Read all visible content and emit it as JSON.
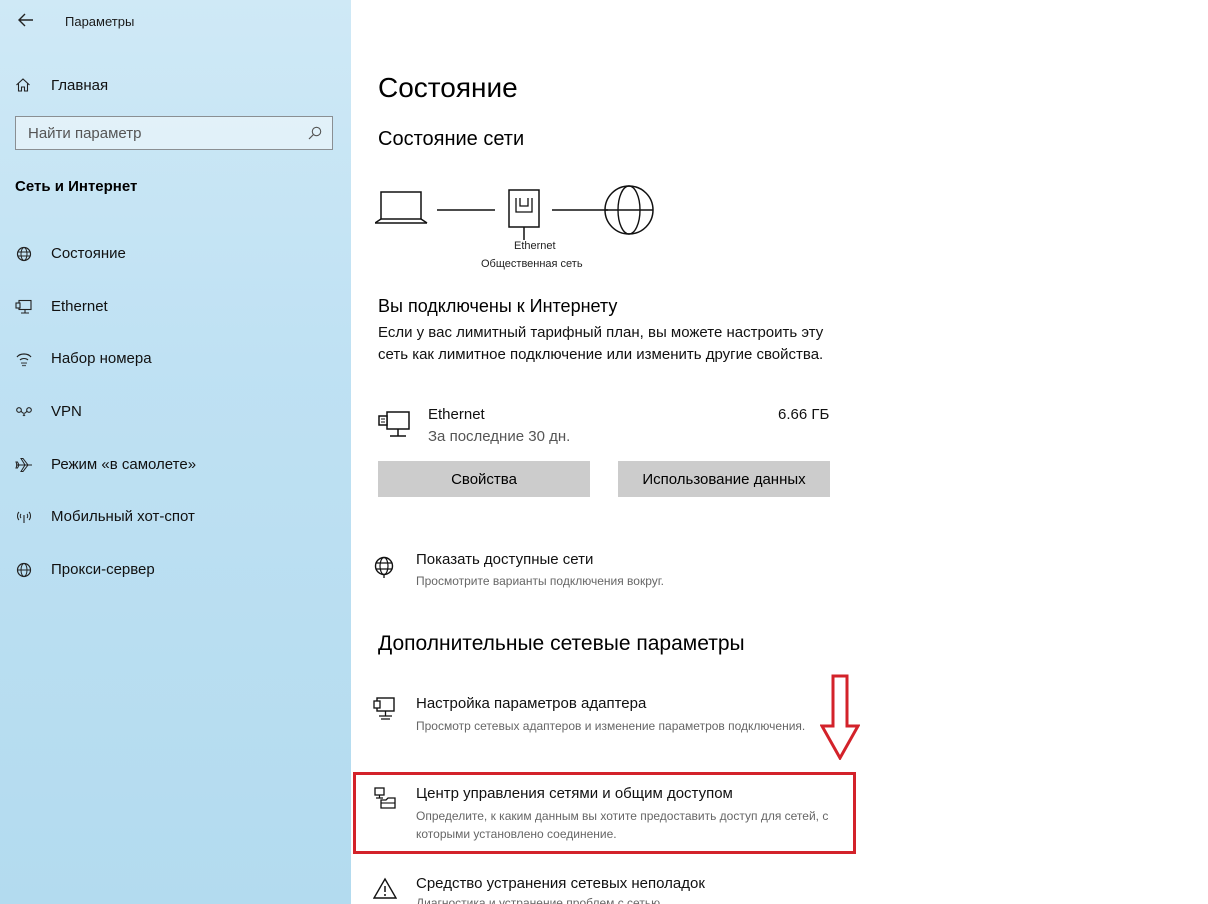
{
  "window": {
    "title": "Параметры"
  },
  "sidebar": {
    "home_label": "Главная",
    "search": {
      "placeholder": "Найти параметр"
    },
    "section_title": "Сеть и Интернет",
    "items": [
      {
        "label": "Состояние",
        "icon": "globe-icon"
      },
      {
        "label": "Ethernet",
        "icon": "ethernet-icon"
      },
      {
        "label": "Набор номера",
        "icon": "dialup-icon"
      },
      {
        "label": "VPN",
        "icon": "vpn-icon"
      },
      {
        "label": "Режим «в самолете»",
        "icon": "airplane-icon"
      },
      {
        "label": "Мобильный хот-спот",
        "icon": "hotspot-icon"
      },
      {
        "label": "Прокси-сервер",
        "icon": "globe-icon"
      }
    ]
  },
  "main": {
    "page_title": "Состояние",
    "network_status_title": "Состояние сети",
    "diagram": {
      "adapter_label": "Ethernet",
      "network_type": "Общественная сеть"
    },
    "connected": {
      "title": "Вы подключены к Интернету",
      "description": "Если у вас лимитный тарифный план, вы можете настроить эту сеть как лимитное подключение или изменить другие свойства."
    },
    "adapter": {
      "name": "Ethernet",
      "period": "За последние 30 дн.",
      "usage": "6.66 ГБ"
    },
    "buttons": {
      "properties": "Свойства",
      "data_usage": "Использование данных"
    },
    "show_networks": {
      "title": "Показать доступные сети",
      "description": "Просмотрите варианты подключения вокруг."
    },
    "advanced_title": "Дополнительные сетевые параметры",
    "advanced_items": [
      {
        "title": "Настройка параметров адаптера",
        "description": "Просмотр сетевых адаптеров и изменение параметров подключения."
      },
      {
        "title": "Центр управления сетями и общим доступом",
        "description": "Определите, к каким данным вы хотите предоставить доступ для сетей, с которыми установлено соединение."
      },
      {
        "title": "Средство устранения сетевых неполадок",
        "description": "Диагностика и устранение проблем с сетью."
      }
    ]
  },
  "annotation": {
    "highlight_color": "#d3222a"
  }
}
